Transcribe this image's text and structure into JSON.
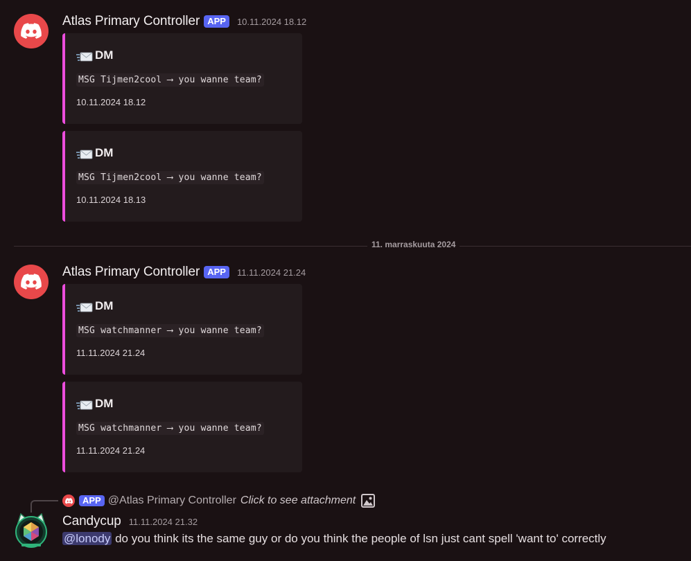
{
  "messages": [
    {
      "author": "Atlas Primary Controller",
      "badge": "APP",
      "timestamp": "10.11.2024 18.12",
      "embeds": [
        {
          "icon": "envelope-icon",
          "title": "DM",
          "description": "MSG Tijmen2cool ⟶ you wanne team?",
          "footer": "10.11.2024 18.12"
        },
        {
          "icon": "envelope-icon",
          "title": "DM",
          "description": "MSG Tijmen2cool ⟶ you wanne team?",
          "footer": "10.11.2024 18.13"
        }
      ]
    },
    {
      "author": "Atlas Primary Controller",
      "badge": "APP",
      "timestamp": "11.11.2024 21.24",
      "embeds": [
        {
          "icon": "envelope-icon",
          "title": "DM",
          "description": "MSG watchmanner ⟶ you wanne team?",
          "footer": "11.11.2024 21.24"
        },
        {
          "icon": "envelope-icon",
          "title": "DM",
          "description": "MSG watchmanner ⟶ you wanne team?",
          "footer": "11.11.2024 21.24"
        }
      ]
    }
  ],
  "date_divider": "11. marraskuuta 2024",
  "reply": {
    "badge": "APP",
    "mention_user": "@Atlas Primary Controller",
    "text": "Click to see attachment",
    "icon": "image-icon"
  },
  "user_message": {
    "author": "Candycup",
    "timestamp": "11.11.2024 21.32",
    "mention": "@lonody",
    "text": " do you think its the same guy or do you think the people of lsn just cant spell 'want to' correctly"
  },
  "colors": {
    "background": "#1a1113",
    "embed_bg": "#231b1d",
    "embed_accent": "#ec4ddd",
    "app_badge": "#5865f2",
    "bot_avatar": "#e8484a"
  }
}
